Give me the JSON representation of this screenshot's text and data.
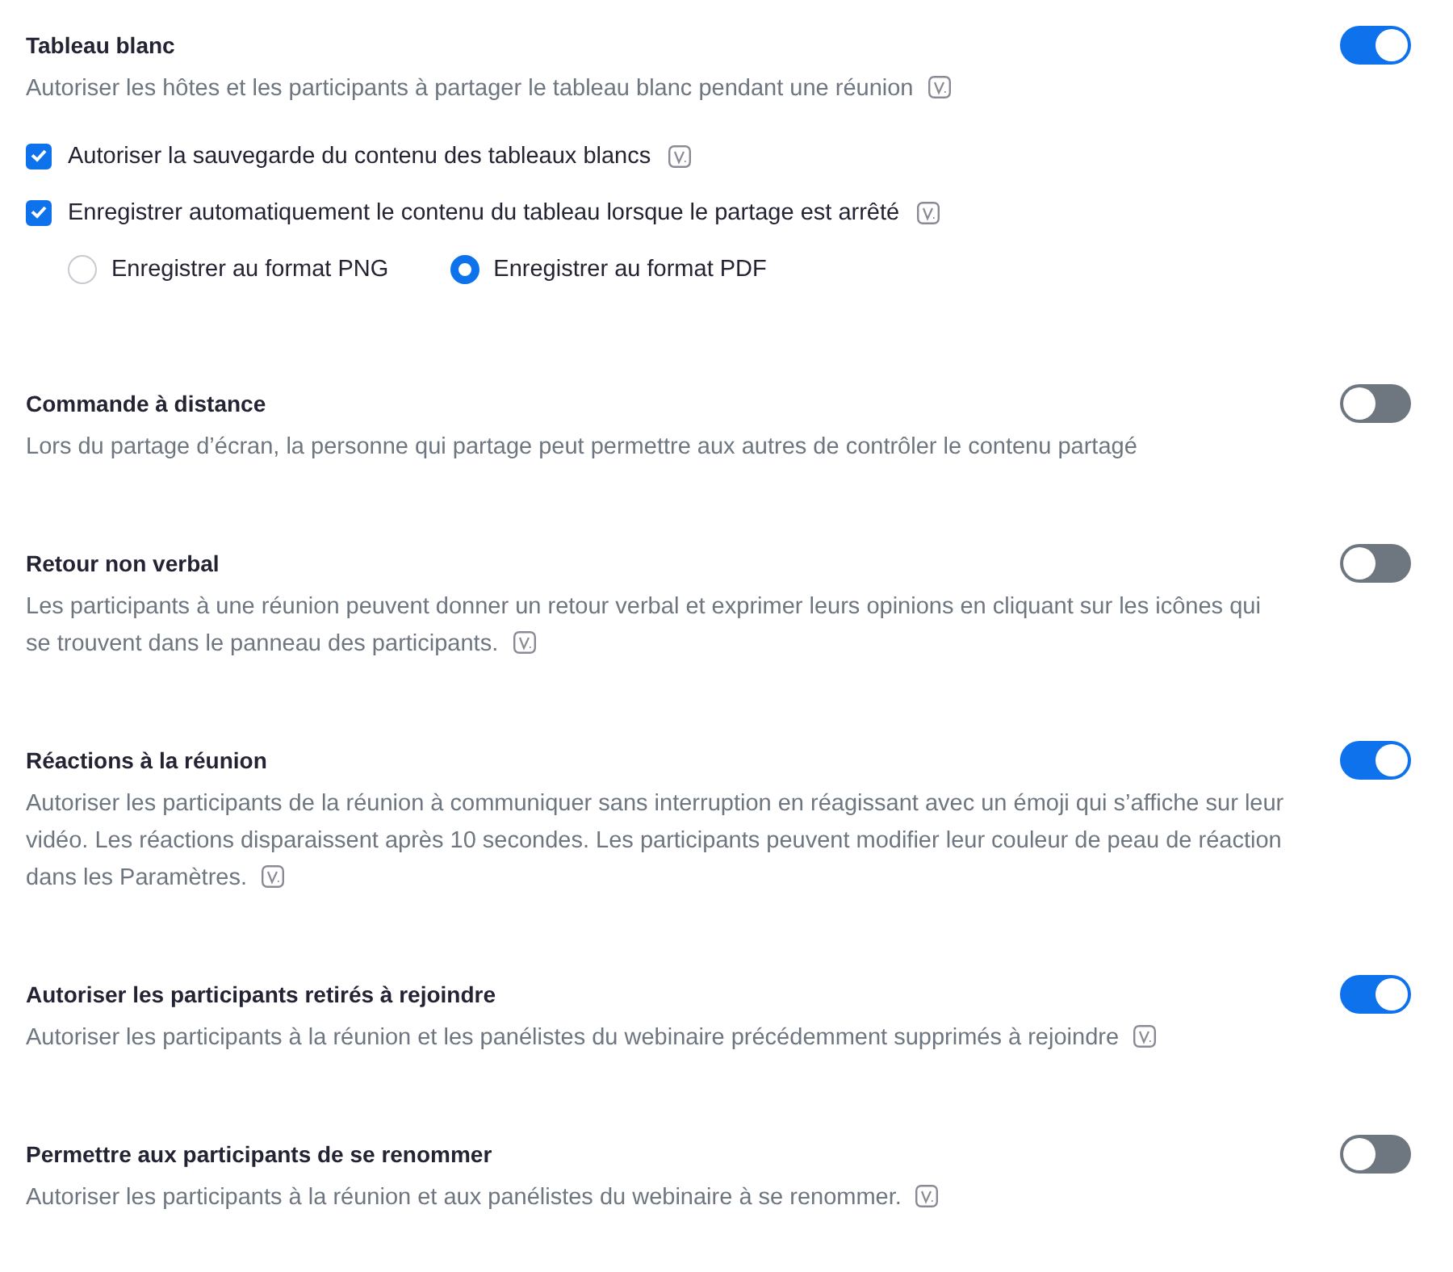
{
  "sections": [
    {
      "title": "Tableau blanc",
      "description": "Autoriser les hôtes et les participants à partager le tableau blanc pendant une réunion",
      "badge": true,
      "on": true,
      "checkboxes": [
        {
          "label": "Autoriser la sauvegarde du contenu des tableaux blancs",
          "checked": true,
          "badge": true
        },
        {
          "label": "Enregistrer automatiquement le contenu du tableau lorsque le partage est arrêté",
          "checked": true,
          "badge": true
        }
      ],
      "radios": [
        {
          "label": "Enregistrer au format PNG",
          "selected": false
        },
        {
          "label": "Enregistrer au format PDF",
          "selected": true
        }
      ]
    },
    {
      "title": "Commande à distance",
      "description": "Lors du partage d’écran, la personne qui partage peut permettre aux autres de contrôler le contenu partagé",
      "badge": false,
      "on": false
    },
    {
      "title": "Retour non verbal",
      "description": "Les participants à une réunion peuvent donner un retour verbal et exprimer leurs opinions en cliquant sur les icônes qui se trouvent dans le panneau des participants.",
      "badge": true,
      "on": false
    },
    {
      "title": "Réactions à la réunion",
      "description": "Autoriser les participants de la réunion à communiquer sans interruption en réagissant avec un émoji qui s’affiche sur leur vidéo. Les réactions disparaissent après 10 secondes. Les participants peuvent modifier leur couleur de peau de réaction dans les Paramètres.",
      "badge": true,
      "on": true
    },
    {
      "title": "Autoriser les participants retirés à rejoindre",
      "description": "Autoriser les participants à la réunion et les panélistes du webinaire précédemment supprimés à rejoindre",
      "badge": true,
      "on": true
    },
    {
      "title": "Permettre aux participants de se renommer",
      "description": "Autoriser les participants à la réunion et aux panélistes du webinaire à se renommer.",
      "badge": true,
      "on": false
    }
  ]
}
